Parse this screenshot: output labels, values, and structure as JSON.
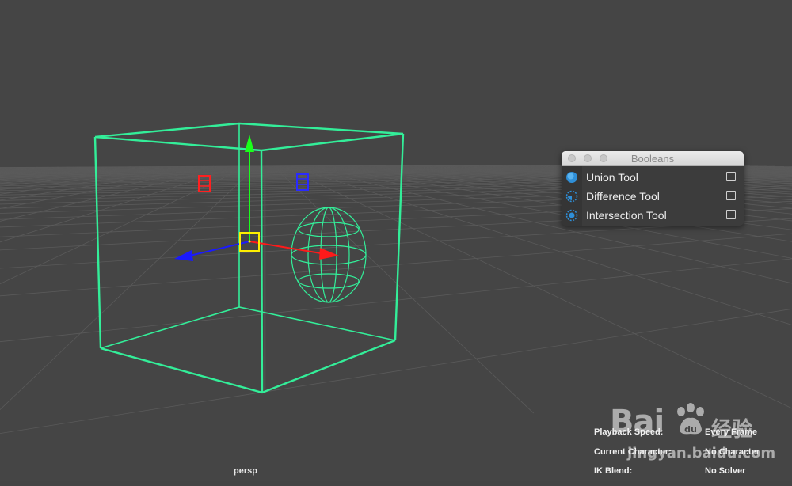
{
  "viewport": {
    "camera_label": "persp",
    "background_color": "#454545",
    "grid_color": "#5a5a5a",
    "selection_color": "#33ee99"
  },
  "hud": [
    {
      "label": "Playback Speed:",
      "value": "Every Frame"
    },
    {
      "label": "Current Character:",
      "value": "No Character"
    },
    {
      "label": "IK Blend:",
      "value": "No Solver"
    }
  ],
  "booleans_panel": {
    "title": "Booleans",
    "tools": [
      {
        "label": "Union Tool",
        "icon": "union-icon",
        "checked": false
      },
      {
        "label": "Difference Tool",
        "icon": "difference-icon",
        "checked": false
      },
      {
        "label": "Intersection Tool",
        "icon": "intersection-icon",
        "checked": false
      }
    ]
  },
  "watermark": {
    "brand": "Bai",
    "brand_suffix": "du",
    "cn_text": "经验",
    "url": "jingyan.baidu.com"
  },
  "axis_colors": {
    "x": "#ff1a1a",
    "y": "#1aff1a",
    "z": "#1a1aff",
    "pivot": "#ffee00"
  }
}
